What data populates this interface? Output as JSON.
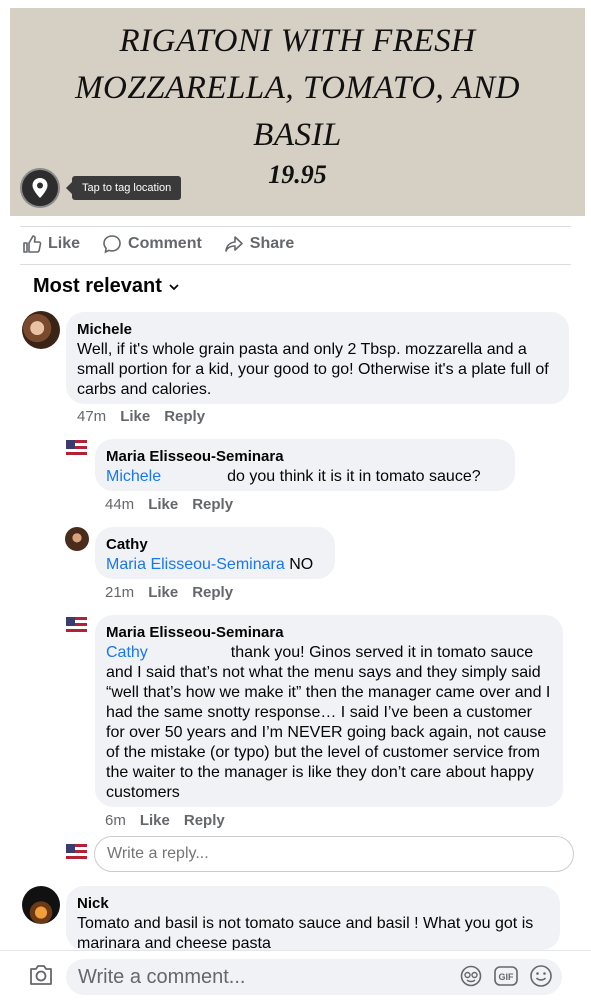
{
  "post_image": {
    "menu_lines": [
      "RIGATONI WITH FRESH",
      "MOZZARELLA, TOMATO, AND",
      "BASIL"
    ],
    "price": "19.95",
    "location_tooltip": "Tap to tag location"
  },
  "actions": {
    "like": "Like",
    "comment": "Comment",
    "share": "Share"
  },
  "sort_label": "Most relevant",
  "comments": [
    {
      "author": "Michele",
      "text": "Well, if it's whole grain pasta and only 2 Tbsp. mozzarella and a small portion for a kid, your good to go! Otherwise it's a plate full of carbs and calories.",
      "time": "47m",
      "like": "Like",
      "reply": "Reply"
    },
    {
      "author": "Maria Elisseou-Seminara",
      "mention": "Michele",
      "text": "do you think it is it in tomato sauce?",
      "time": "44m",
      "like": "Like",
      "reply": "Reply"
    },
    {
      "author": "Cathy",
      "mention": "Maria Elisseou-Seminara",
      "text": "NO",
      "time": "21m",
      "like": "Like",
      "reply": "Reply"
    },
    {
      "author": "Maria Elisseou-Seminara",
      "mention": "Cathy",
      "text": "thank you! Ginos served it in tomato sauce and I said that’s not what the menu says and they simply said “well that’s how we make it” then the manager came over and I had the same snotty response… I said I’ve been a customer for over 50 years and I’m NEVER going back again, not cause of the mistake (or typo) but the level of customer service from the waiter to the manager is like they don’t care about happy customers",
      "time": "6m",
      "like": "Like",
      "reply": "Reply"
    },
    {
      "author": "Nick",
      "text": "Tomato and basil is not tomato sauce and basil ! What you got is marinara and cheese pasta"
    }
  ],
  "reply_placeholder": "Write a reply...",
  "comment_placeholder": "Write a comment...",
  "bar_icons": [
    "camera-icon",
    "avatar-sticker-icon",
    "gif-icon",
    "emoji-icon"
  ],
  "colors": {
    "link": "#1877f2",
    "bubble": "#f0f2f5",
    "secondary_text": "#65676b"
  }
}
